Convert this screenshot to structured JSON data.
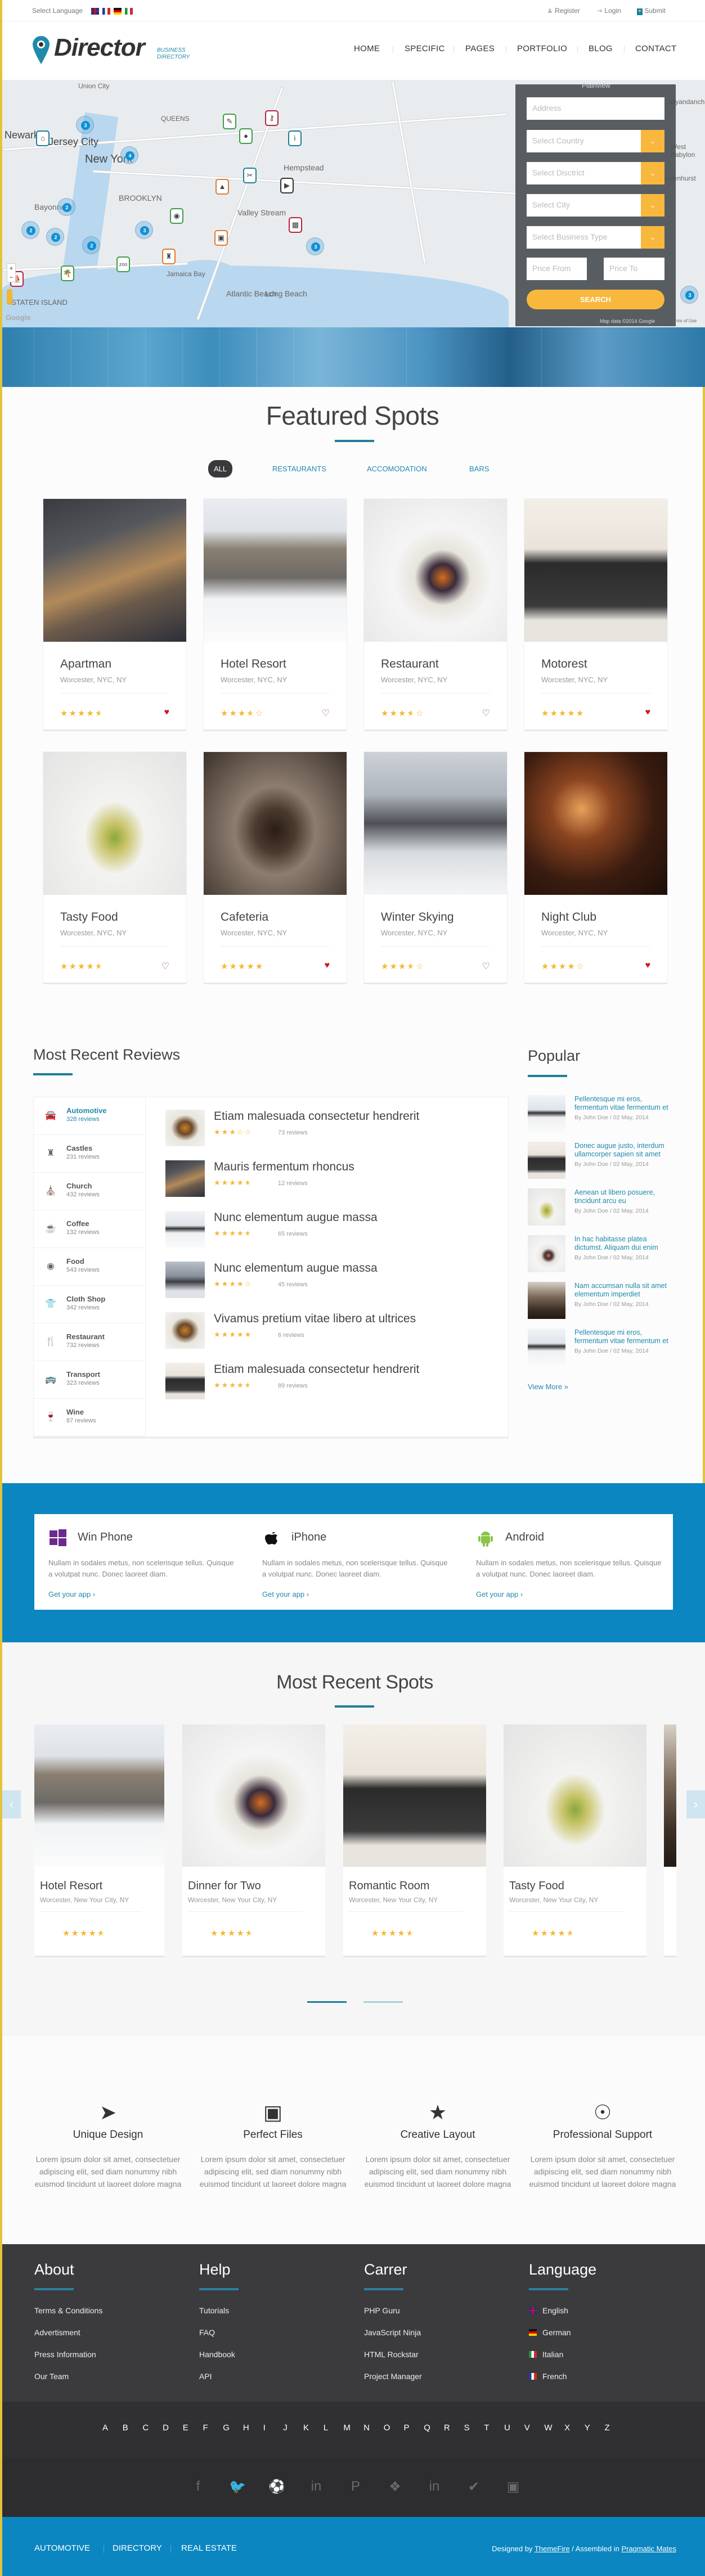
{
  "topbar": {
    "select_language": "Select Language",
    "flags": [
      "english-flag",
      "french-flag",
      "german-flag",
      "italian-flag"
    ],
    "register": "Register",
    "login": "Login",
    "submit": "Submit"
  },
  "header": {
    "logo": "Director",
    "tagline_1": "BUSINESS",
    "tagline_2": "DIRECTORY",
    "nav": [
      {
        "label": "HOME"
      },
      {
        "label": "SPECIFIC"
      },
      {
        "label": "PAGES"
      },
      {
        "label": "PORTFOLIO"
      },
      {
        "label": "BLOG"
      },
      {
        "label": "CONTACT"
      }
    ]
  },
  "map": {
    "labels": [
      "Union City",
      "Newark",
      "Jersey City",
      "New York",
      "QUEENS",
      "BROOKLYN",
      "Bayonne",
      "Hempstead",
      "Valley Stream",
      "Jamaica Bay",
      "Long Beach",
      "Atlantic Beach",
      "Plainview",
      "Wyandanch",
      "West Babylon",
      "Lindenhurst",
      "STATEN ISLAND"
    ],
    "clusters": [
      3,
      4,
      2,
      2,
      2,
      2,
      3,
      3,
      3
    ],
    "google": "Google",
    "attribution": "Map data ©2014 Google",
    "terms": "Terms of Use"
  },
  "search": {
    "address_placeholder": "Address",
    "country": "Select Country",
    "district": "Select Disctrict",
    "city": "Select City",
    "business_type": "Select Business Type",
    "price_from": "Price From",
    "price_to": "Price To",
    "button": "SEARCH",
    "accent": "#f8b83e"
  },
  "featured": {
    "title": "Featured Spots",
    "filters": [
      {
        "label": "ALL",
        "active": true
      },
      {
        "label": "RESTAURANTS",
        "active": false
      },
      {
        "label": "ACCOMODATION",
        "active": false
      },
      {
        "label": "BARS",
        "active": false
      }
    ],
    "cards": [
      {
        "name": "Apartman",
        "location": "Worcester, NYC, NY",
        "rating": 4.5,
        "liked": true
      },
      {
        "name": "Hotel Resort",
        "location": "Worcester, NYC, NY",
        "rating": 3.5,
        "liked": false
      },
      {
        "name": "Restaurant",
        "location": "Worcester, NYC, NY",
        "rating": 3.5,
        "liked": false
      },
      {
        "name": "Motorest",
        "location": "Worcester, NYC, NY",
        "rating": 5,
        "liked": true
      },
      {
        "name": "Tasty Food",
        "location": "Worcester, NYC, NY",
        "rating": 4.5,
        "liked": false
      },
      {
        "name": "Cafeteria",
        "location": "Worcester, NYC, NY",
        "rating": 5,
        "liked": true
      },
      {
        "name": "Winter Skying",
        "location": "Worcester, NYC, NY",
        "rating": 3.5,
        "liked": false
      },
      {
        "name": "Night Club",
        "location": "Worcester, NYC, NY",
        "rating": 4,
        "liked": true
      }
    ]
  },
  "reviews": {
    "title": "Most Recent Reviews",
    "categories": [
      {
        "name": "Automotive",
        "count": "328 reviews",
        "icon": "car-icon",
        "active": true
      },
      {
        "name": "Castles",
        "count": "231 reviews",
        "icon": "castle-icon"
      },
      {
        "name": "Church",
        "count": "432 reviews",
        "icon": "church-icon"
      },
      {
        "name": "Coffee",
        "count": "132 reviews",
        "icon": "coffee-icon"
      },
      {
        "name": "Food",
        "count": "543 reviews",
        "icon": "steak-icon"
      },
      {
        "name": "Cloth Shop",
        "count": "342 reviews",
        "icon": "tshirt-icon"
      },
      {
        "name": "Restaurant",
        "count": "732 reviews",
        "icon": "cutlery-icon"
      },
      {
        "name": "Transport",
        "count": "323 reviews",
        "icon": "bus-icon"
      },
      {
        "name": "Wine",
        "count": "87 reviews",
        "icon": "wine-glass-icon"
      }
    ],
    "items": [
      {
        "title": "Etiam malesuada consectetur hendrerit",
        "rating": 3,
        "count": "73 reviews"
      },
      {
        "title": "Mauris fermentum rhoncus",
        "rating": 4.5,
        "count": "12 reviews"
      },
      {
        "title": "Nunc elementum augue massa",
        "rating": 4.5,
        "count": "65 reviews"
      },
      {
        "title": "Nunc elementum augue massa",
        "rating": 4,
        "count": "45 reviews"
      },
      {
        "title": "Vivamus pretium vitae libero at ultrices",
        "rating": 5,
        "count": "6 reviews"
      },
      {
        "title": "Etiam malesuada consectetur hendrerit",
        "rating": 4.5,
        "count": "89 reviews"
      }
    ]
  },
  "popular": {
    "title": "Popular",
    "items": [
      {
        "title": "Pellentesque mi eros, fermentum vitae fermentum et",
        "meta": "By John Doe / 02 May, 2014"
      },
      {
        "title": "Donec augue justo, interdum ullamcorper sapien sit amet",
        "meta": "By John Doe / 02 May, 2014"
      },
      {
        "title": "Aenean ut libero posuere, tincidunt arcu eu",
        "meta": "By John Doe / 02 May, 2014"
      },
      {
        "title": "In hac habitasse platea dictumst. Aliquam dui enim",
        "meta": "By John Doe / 02 May, 2014"
      },
      {
        "title": "Nam accumsan nulla sit amet elementum imperdiet",
        "meta": "By John Doe / 02 May, 2014"
      },
      {
        "title": "Pellentesque mi eros, fermentum vitae fermentum et",
        "meta": "By John Doe / 02 May, 2014"
      }
    ],
    "view_more": "View More  »"
  },
  "apps": {
    "items": [
      {
        "name": "Win Phone",
        "icon": "windows-icon",
        "description": "Nullam in sodales metus, non scelerisque tellus. Quisque a volutpat nunc. Donec laoreet diam.",
        "link": "Get your app  ›"
      },
      {
        "name": "iPhone",
        "icon": "apple-icon",
        "description": "Nullam in sodales metus, non scelerisque tellus. Quisque a volutpat nunc. Donec laoreet diam.",
        "link": "Get your app  ›"
      },
      {
        "name": "Android",
        "icon": "android-icon",
        "description": "Nullam in sodales metus, non scelerisque tellus. Quisque a volutpat nunc. Donec laoreet diam.",
        "link": "Get your app  ›"
      }
    ]
  },
  "recent": {
    "title": "Most Recent Spots",
    "cards": [
      {
        "name": "Hotel Resort",
        "location": "Worcester, New Your City, NY",
        "rating": 4.5
      },
      {
        "name": "Dinner for Two",
        "location": "Worcester, New Your City, NY",
        "rating": 4.5
      },
      {
        "name": "Romantic Room",
        "location": "Worcester, New Your City, NY",
        "rating": 4.5
      },
      {
        "name": "Tasty Food",
        "location": "Worcester, New Your City, NY",
        "rating": 4.5
      }
    ],
    "prev_icon": "‹",
    "next_icon": "›",
    "active_page": 1,
    "pages": 2
  },
  "features": {
    "items": [
      {
        "title": "Unique Design",
        "icon": "paper-plane-icon",
        "text": "Lorem ipsum dolor sit amet, consectetuer adipiscing elit, sed diam nonummy nibh euismod tincidunt ut laoreet dolore magna"
      },
      {
        "title": "Perfect Files",
        "icon": "archive-icon",
        "text": "Lorem ipsum dolor sit amet, consectetuer adipiscing elit, sed diam nonummy nibh euismod tincidunt ut laoreet dolore magna"
      },
      {
        "title": "Creative Layout",
        "icon": "star-icon",
        "text": "Lorem ipsum dolor sit amet, consectetuer adipiscing elit, sed diam nonummy nibh euismod tincidunt ut laoreet dolore magna"
      },
      {
        "title": "Professional Support",
        "icon": "lifebuoy-icon",
        "text": "Lorem ipsum dolor sit amet, consectetuer adipiscing elit, sed diam nonummy nibh euismod tincidunt ut laoreet dolore magna"
      }
    ]
  },
  "footer": {
    "columns": [
      {
        "title": "About",
        "links": [
          "Terms & Conditions",
          "Advertisment",
          "Press Information",
          "Our Team"
        ]
      },
      {
        "title": "Help",
        "links": [
          "Tutorials",
          "FAQ",
          "Handbook",
          "API"
        ]
      },
      {
        "title": "Carrer",
        "links": [
          "PHP Guru",
          "JavaScript Ninja",
          "HTML Rockstar",
          "Project Manager"
        ]
      },
      {
        "title": "Language",
        "links": [
          "English",
          "German",
          "Italian",
          "French"
        ]
      }
    ],
    "alphabet": [
      "A",
      "B",
      "C",
      "D",
      "E",
      "F",
      "G",
      "H",
      "I",
      "J",
      "K",
      "L",
      "M",
      "N",
      "O",
      "P",
      "Q",
      "R",
      "S",
      "T",
      "U",
      "V",
      "W",
      "X",
      "Y",
      "Z"
    ],
    "social": [
      "facebook-icon",
      "twitter-icon",
      "dribbble-icon",
      "linkedin-icon",
      "pinterest-icon",
      "dropbox-icon",
      "linkedin-icon",
      "foursquare-icon",
      "instagram-icon"
    ],
    "bottom_links": [
      "AUTOMOTIVE",
      "DIRECTORY",
      "REAL ESTATE"
    ],
    "designed_by": "Designed by ",
    "themefire": "ThemeFire",
    "assembled": " / Assembled in ",
    "pragmatic": "Pragmatic Mates"
  },
  "colors": {
    "accent": "#1f8bab",
    "yellow": "#f8b83e",
    "blue_band": "#0b86c0",
    "footer_dark": "#3b3b3d",
    "star": "#f5b731",
    "heart": "#d0161b"
  }
}
